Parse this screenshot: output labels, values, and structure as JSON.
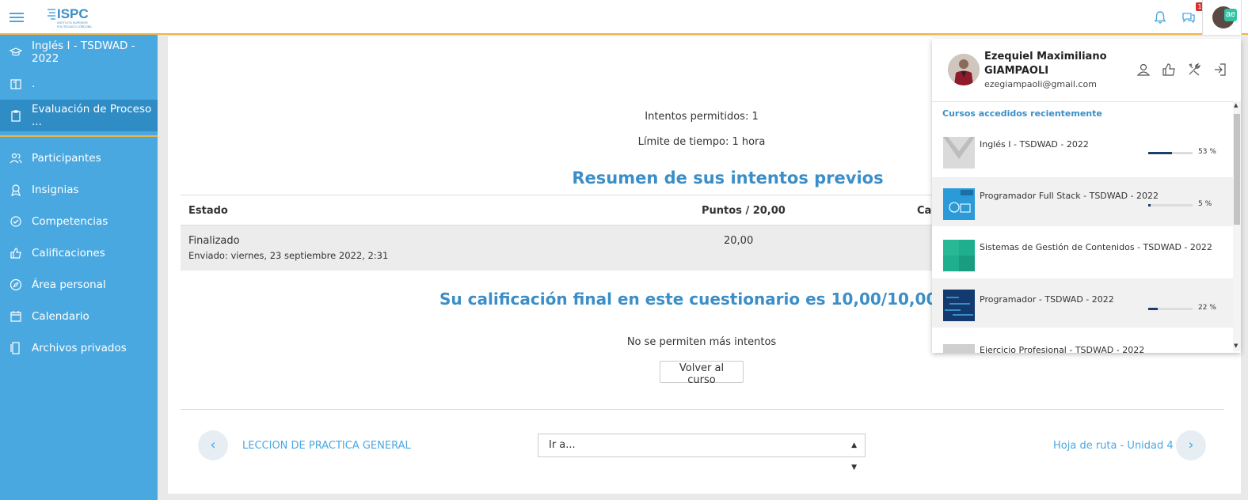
{
  "header": {
    "logo_text": "ISPC",
    "logo_subtext": "INSTITUTO SUPERIOR POLITÉCNICO CÓRDOBA",
    "notification_count": "1",
    "user_initials": "ae"
  },
  "sidebar": {
    "items": [
      {
        "label": "Inglés I - TSDWAD - 2022",
        "icon": "graduation-cap-icon"
      },
      {
        "label": ".",
        "icon": "book-icon"
      },
      {
        "label": "Evaluación de Proceso ...",
        "icon": "clipboard-icon"
      },
      {
        "label": "Participantes",
        "icon": "users-icon"
      },
      {
        "label": "Insignias",
        "icon": "award-icon"
      },
      {
        "label": "Competencias",
        "icon": "check-circle-icon"
      },
      {
        "label": "Calificaciones",
        "icon": "thumbs-up-icon"
      },
      {
        "label": "Área personal",
        "icon": "compass-icon"
      },
      {
        "label": "Calendario",
        "icon": "calendar-icon"
      },
      {
        "label": "Archivos privados",
        "icon": "file-icon"
      }
    ]
  },
  "main": {
    "attempts_allowed": "Intentos permitidos: 1",
    "time_limit": "Límite de tiempo: 1 hora",
    "summary_heading": "Resumen de sus intentos previos",
    "table": {
      "headers": [
        "Estado",
        "Puntos / 20,00",
        "Cal"
      ],
      "rows": [
        {
          "estado": "Finalizado",
          "enviado": "Enviado: viernes, 23 septiembre 2022, 2:31",
          "puntos": "20,00"
        }
      ]
    },
    "final_grade": "Su calificación final en este cuestionario es 10,00/10,00.",
    "no_more_attempts": "No se permiten más intentos",
    "back_button": "Volver al curso",
    "prev_link": "LECCION DE PRACTICA GENERAL",
    "jump_select": "Ir a...",
    "next_link": "Hoja de ruta - Unidad 4"
  },
  "user_menu": {
    "name_line1": "Ezequiel Maximiliano",
    "name_line2": "GIAMPAOLI",
    "email": "ezegiampaoli@gmail.com",
    "recent_title": "Cursos accedidos recientemente",
    "courses": [
      {
        "name": "Inglés I - TSDWAD - 2022",
        "progress": "53 %",
        "progress_value": 53,
        "thumb_color": "#d9d9d9"
      },
      {
        "name": "Programador Full Stack - TSDWAD - 2022",
        "progress": "5 %",
        "progress_value": 5,
        "thumb_color": "#2a9ad8"
      },
      {
        "name": "Sistemas de Gestión de Contenidos - TSDWAD - 2022",
        "progress": "",
        "progress_value": null,
        "thumb_color": "#1fae8e"
      },
      {
        "name": "Programador - TSDWAD - 2022",
        "progress": "22 %",
        "progress_value": 22,
        "thumb_color": "#123a6e"
      },
      {
        "name": "Ejercicio Profesional - TSDWAD - 2022",
        "progress": "",
        "progress_value": null,
        "thumb_color": "#cfcfcf"
      }
    ]
  },
  "colors": {
    "sidebar_bg": "#4aa8e0",
    "sidebar_active": "#2f8cc5",
    "accent_yellow": "#f0b443",
    "heading_blue": "#3b8ec7"
  }
}
